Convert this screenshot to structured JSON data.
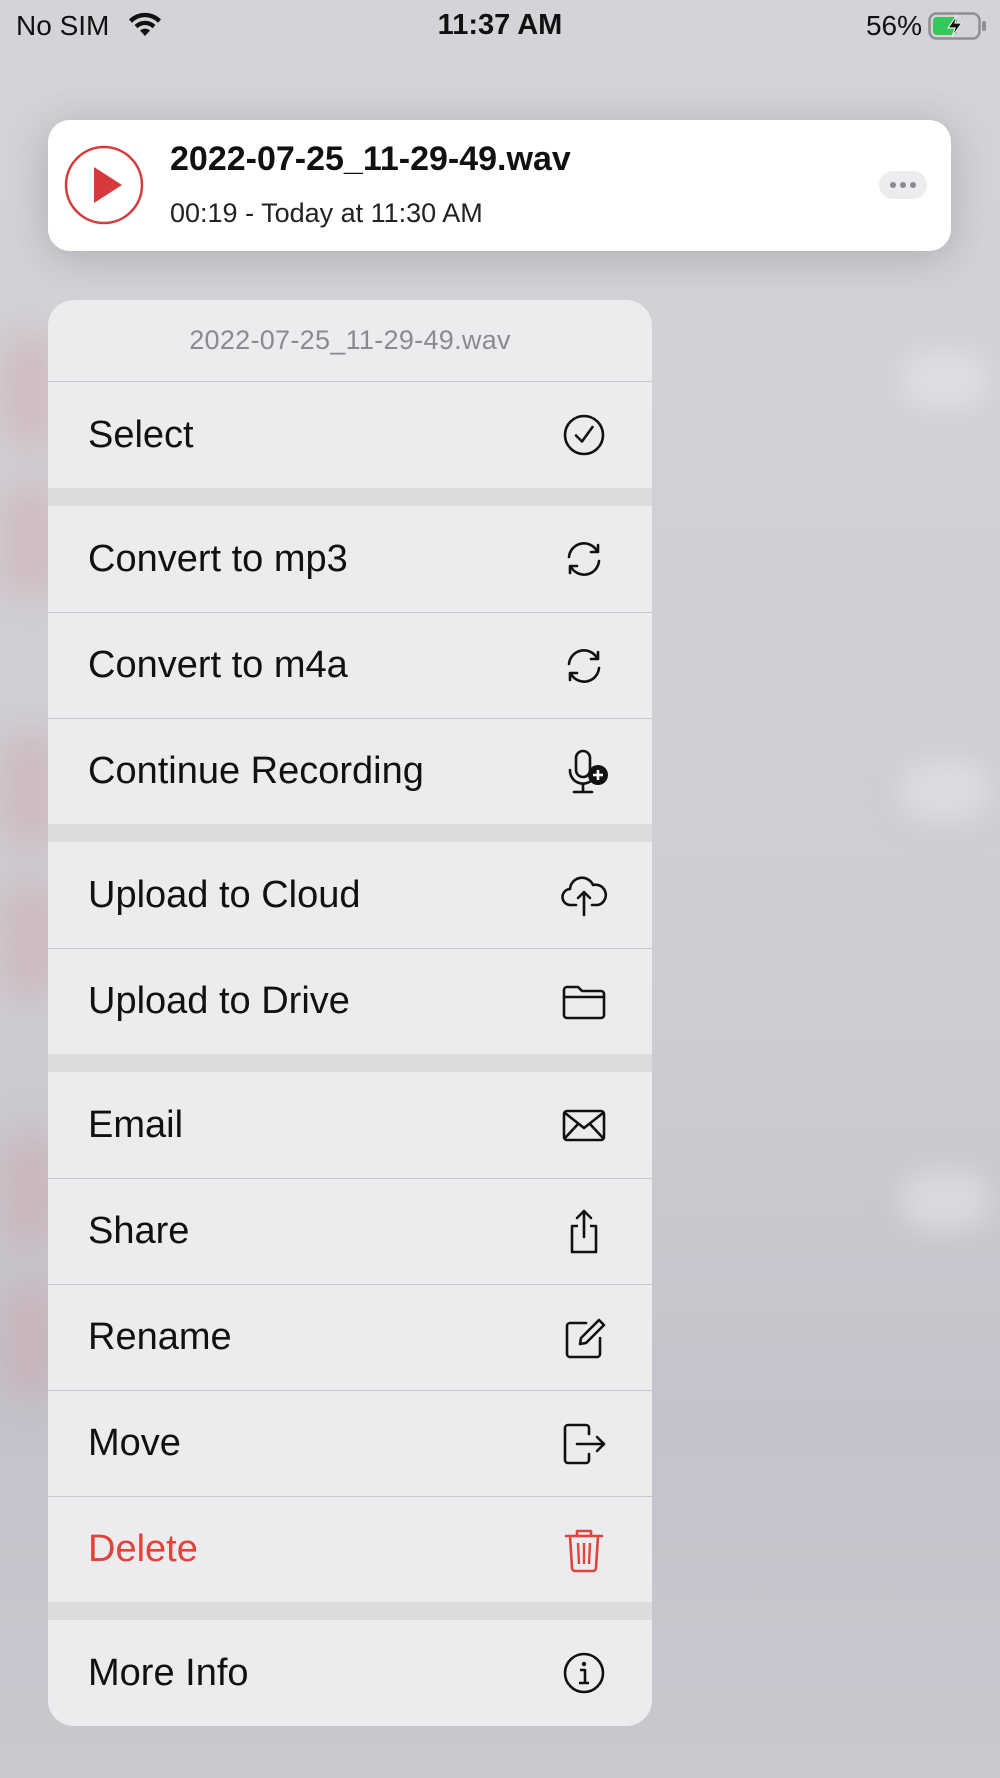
{
  "status_bar": {
    "carrier": "No SIM",
    "time": "11:37 AM",
    "battery_percent": "56%",
    "battery_level": 0.56,
    "charging": true
  },
  "player": {
    "file_name": "2022-07-25_11-29-49.wav",
    "subtitle": "00:19 - Today at 11:30 AM",
    "accent_color": "#d63a3a"
  },
  "menu": {
    "header": "2022-07-25_11-29-49.wav",
    "items": [
      {
        "label": "Select",
        "icon": "checkmark-circle-icon"
      },
      {
        "label": "Convert to mp3",
        "icon": "convert-arrows-icon"
      },
      {
        "label": "Convert to m4a",
        "icon": "convert-arrows-icon"
      },
      {
        "label": "Continue Recording",
        "icon": "mic-plus-icon"
      },
      {
        "label": "Upload to Cloud",
        "icon": "cloud-upload-icon"
      },
      {
        "label": "Upload to Drive",
        "icon": "folder-icon"
      },
      {
        "label": "Email",
        "icon": "envelope-icon"
      },
      {
        "label": "Share",
        "icon": "share-icon"
      },
      {
        "label": "Rename",
        "icon": "edit-icon"
      },
      {
        "label": "Move",
        "icon": "move-out-icon"
      },
      {
        "label": "Delete",
        "icon": "trash-icon",
        "destructive": true
      },
      {
        "label": "More Info",
        "icon": "info-icon"
      }
    ],
    "destructive_color": "#e0443b"
  }
}
